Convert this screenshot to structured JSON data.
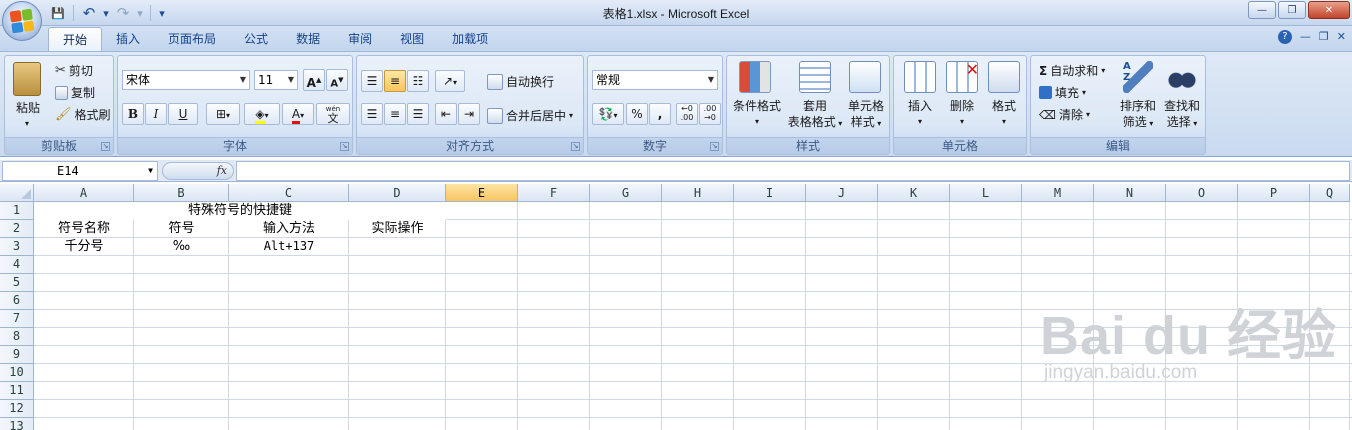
{
  "window": {
    "title": "表格1.xlsx - Microsoft Excel",
    "controls": [
      "minimize",
      "restore",
      "close"
    ]
  },
  "office_button": {
    "icon": "office-logo-icon",
    "colors": [
      "#e9541f",
      "#7cbb28",
      "#2f8be0",
      "#f7b719"
    ]
  },
  "quick_access": [
    {
      "name": "save-icon",
      "glyph": "💾"
    },
    {
      "name": "undo-icon",
      "glyph": "↶"
    },
    {
      "name": "undo-dropdown-icon",
      "glyph": "▾"
    },
    {
      "name": "redo-icon",
      "glyph": "↷"
    },
    {
      "name": "redo-dropdown-icon",
      "glyph": "▾"
    },
    {
      "name": "customize-qat-icon",
      "glyph": "▾"
    }
  ],
  "tabs": [
    "开始",
    "插入",
    "页面布局",
    "公式",
    "数据",
    "审阅",
    "视图",
    "加载项"
  ],
  "active_tab": "开始",
  "ribbon": {
    "clipboard": {
      "label": "剪贴板",
      "paste": "粘贴",
      "cut": "剪切",
      "copy": "复制",
      "format_painter": "格式刷"
    },
    "font": {
      "label": "字体",
      "font_name": "宋体",
      "font_size": "11",
      "bold": "B",
      "italic": "I",
      "underline": "U",
      "grow": "A",
      "shrink": "A",
      "wen": "wén",
      "wen_char": "文"
    },
    "alignment": {
      "label": "对齐方式",
      "wrap_text": "自动换行",
      "merge_center": "合并后居中"
    },
    "number": {
      "label": "数字",
      "format": "常规",
      "percent": "%",
      "comma": ",",
      "inc_dec": "+.0\n.00",
      "dec_dec": ".00\n→.0"
    },
    "styles": {
      "label": "样式",
      "conditional": "条件格式",
      "table_line1": "套用",
      "table_line2": "表格格式",
      "cell_styles_line1": "单元格",
      "cell_styles_line2": "样式"
    },
    "cells": {
      "label": "单元格",
      "insert": "插入",
      "delete": "删除",
      "format": "格式"
    },
    "editing": {
      "label": "编辑",
      "autosum": "自动求和",
      "fill": "填充",
      "clear": "清除",
      "sort_line1": "排序和",
      "sort_line2": "筛选",
      "find_line1": "查找和",
      "find_line2": "选择"
    }
  },
  "formula_bar": {
    "name_box": "E14",
    "fx": "fx",
    "formula": ""
  },
  "sheet": {
    "columns": [
      "A",
      "B",
      "C",
      "D",
      "E",
      "F",
      "G",
      "H",
      "I",
      "J",
      "K",
      "L",
      "M",
      "N",
      "O",
      "P",
      "Q"
    ],
    "rows": [
      "1",
      "2",
      "3",
      "4",
      "5",
      "6",
      "7",
      "8",
      "9",
      "10",
      "11",
      "12",
      "13"
    ],
    "selected_column": "E",
    "cells": {
      "r1_title": "特殊符号的快捷键",
      "a2": "符号名称",
      "b2": "符号",
      "c2": "输入方法",
      "d2": "实际操作",
      "a3": "千分号",
      "b3": "‰",
      "c3": "Alt+137"
    }
  },
  "watermark": {
    "brand": "Bai du 经验",
    "url": "jingyan.baidu.com"
  }
}
